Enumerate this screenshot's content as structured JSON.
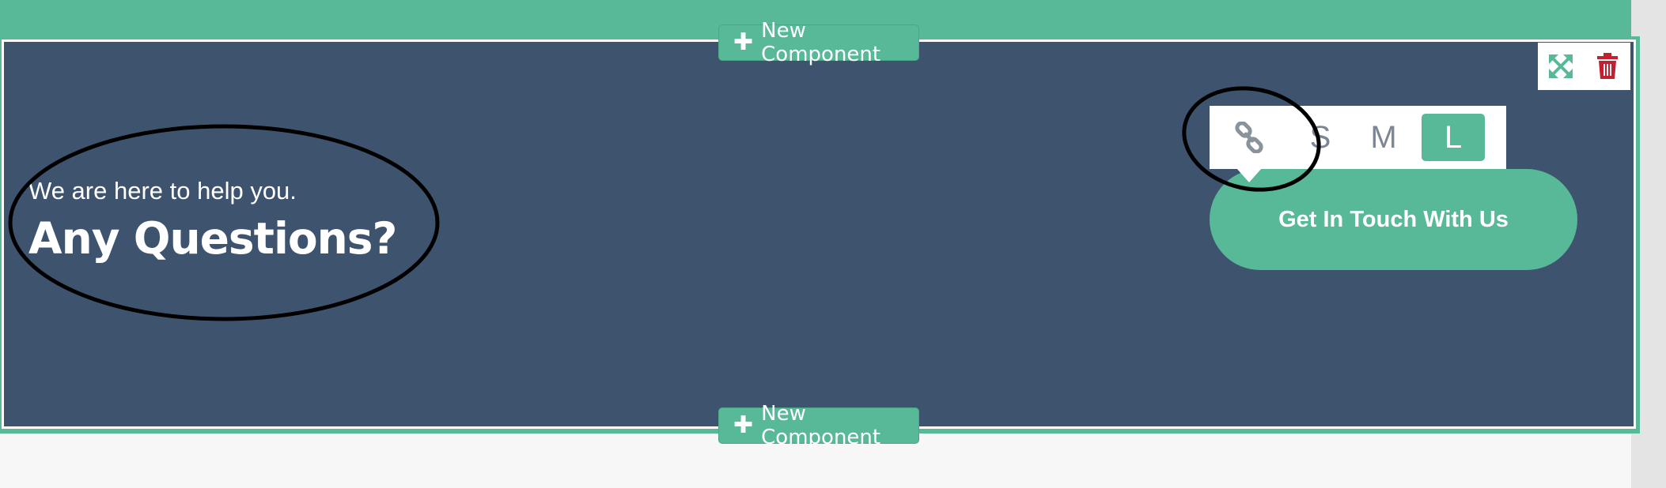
{
  "editor": {
    "new_component_top": "New Component",
    "new_component_bottom": "New Component",
    "plus_icon": "plus-icon",
    "corner_tools": [
      "expand-icon",
      "trash-icon"
    ]
  },
  "hero": {
    "subtitle": "We are here to help you.",
    "title": "Any Questions?"
  },
  "button_toolbar": {
    "link_icon": "link-icon",
    "sizes": [
      "S",
      "M",
      "L"
    ],
    "active_size": "L"
  },
  "cta": {
    "label": "Get In Touch With Us"
  },
  "colors": {
    "accent": "#58b999",
    "section_bg": "#3e536e",
    "delete": "#c0202f",
    "page_bg": "#f7f7f7"
  }
}
